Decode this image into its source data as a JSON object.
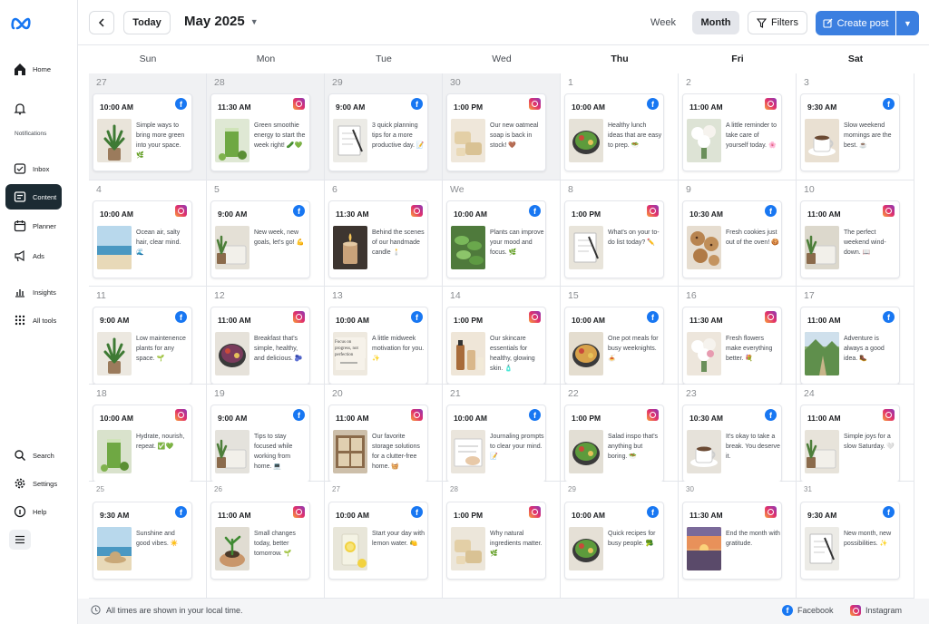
{
  "brand": {
    "logo": "meta-logo",
    "accent": "#3b7fe0",
    "facebook": "#1877f2"
  },
  "sidebar": {
    "items": [
      {
        "name": "home",
        "label": "Home",
        "icon": "home-icon"
      },
      {
        "name": "notifications",
        "label": "Notifications",
        "icon": "bell-icon"
      },
      {
        "name": "inbox",
        "label": "Inbox",
        "icon": "inbox-icon"
      },
      {
        "name": "content",
        "label": "Content",
        "icon": "content-icon",
        "active": true
      },
      {
        "name": "planner",
        "label": "Planner",
        "icon": "calendar-icon"
      },
      {
        "name": "ads",
        "label": "Ads",
        "icon": "megaphone-icon"
      },
      {
        "name": "insights",
        "label": "Insights",
        "icon": "chart-icon"
      },
      {
        "name": "all-tools",
        "label": "All tools",
        "icon": "grid-icon"
      },
      {
        "name": "search",
        "label": "Search",
        "icon": "search-icon"
      },
      {
        "name": "settings",
        "label": "Settings",
        "icon": "gear-icon"
      },
      {
        "name": "help",
        "label": "Help",
        "icon": "help-icon"
      }
    ],
    "menu_icon": "hamburger-icon"
  },
  "toolbar": {
    "today_label": "Today",
    "month_title": "May 2025",
    "week_label": "Week",
    "month_label": "Month",
    "filters_label": "Filters",
    "create_label": "Create post"
  },
  "weekdays": [
    "Sun",
    "Mon",
    "Tue",
    "Wed",
    "Thu",
    "Fri",
    "Sat"
  ],
  "weeks": [
    [
      {
        "day": "27",
        "outside": true,
        "time": "10:00 AM",
        "platform": "facebook",
        "caption": "Simple ways to bring more green into your space. 🌿",
        "image": "potted-plant"
      },
      {
        "day": "28",
        "outside": true,
        "time": "11:30 AM",
        "platform": "instagram",
        "caption": "Green smoothie energy to start the week right! 🥒💚",
        "image": "green-smoothie"
      },
      {
        "day": "29",
        "outside": true,
        "time": "9:00 AM",
        "platform": "facebook",
        "caption": "3 quick planning tips for a more productive day. 📝",
        "image": "notebook"
      },
      {
        "day": "30",
        "outside": true,
        "time": "1:00 PM",
        "platform": "instagram",
        "caption": "Our new oatmeal soap is back in stock! 🤎",
        "image": "soap"
      },
      {
        "day": "1",
        "time": "10:00 AM",
        "platform": "facebook",
        "caption": "Healthy lunch ideas that are easy to prep. 🥗",
        "image": "salad-bowl"
      },
      {
        "day": "2",
        "time": "11:00 AM",
        "platform": "instagram",
        "caption": "A little reminder to take care of yourself today. 🌸",
        "image": "white-flowers"
      },
      {
        "day": "3",
        "time": "9:30 AM",
        "platform": "facebook",
        "caption": "Slow weekend mornings are the best. ☕",
        "image": "coffee-cup"
      }
    ],
    [
      {
        "day": "4",
        "time": "10:00 AM",
        "platform": "instagram",
        "caption": "Ocean air, salty hair, clear mind. 🌊",
        "image": "ocean"
      },
      {
        "day": "5",
        "time": "9:00 AM",
        "platform": "facebook",
        "caption": "New week, new goals, let's go! 💪",
        "image": "plant-towel"
      },
      {
        "day": "6",
        "time": "11:30 AM",
        "platform": "instagram",
        "caption": "Behind the scenes of our handmade candle 🕯️",
        "image": "candle"
      },
      {
        "day": "We",
        "time": "10:00 AM",
        "platform": "facebook",
        "caption": "Plants can improve your mood and focus. 🌿",
        "image": "leafy-plant"
      },
      {
        "day": "8",
        "time": "1:00 PM",
        "platform": "instagram",
        "caption": "What's on your to-do list today? ✏️",
        "image": "todo-notebook"
      },
      {
        "day": "9",
        "time": "10:30 AM",
        "platform": "facebook",
        "caption": "Fresh cookies just out of the oven! 🍪",
        "image": "cookies"
      },
      {
        "day": "10",
        "time": "11:00 AM",
        "platform": "instagram",
        "caption": "The perfect weekend wind-down. 📖",
        "image": "plant-book"
      }
    ],
    [
      {
        "day": "11",
        "time": "9:00 AM",
        "platform": "facebook",
        "caption": "Low maintenence plants for any space. 🌱",
        "image": "snake-plant"
      },
      {
        "day": "12",
        "time": "11:00 AM",
        "platform": "instagram",
        "caption": "Breakfast that's simple, healthy, and delicious. 🫐",
        "image": "berry-bowl"
      },
      {
        "day": "13",
        "time": "10:00 AM",
        "platform": "facebook",
        "caption": "A little midweek motivation for you. ✨",
        "image": "quote-card",
        "image_text": "Focus on progress, not perfection"
      },
      {
        "day": "14",
        "time": "1:00 PM",
        "platform": "instagram",
        "caption": "Our skincare essentials for healthy, glowing skin. 🧴",
        "image": "skincare"
      },
      {
        "day": "15",
        "time": "10:00 AM",
        "platform": "facebook",
        "caption": "One pot meals for busy weeknights. 🍝",
        "image": "pasta"
      },
      {
        "day": "16",
        "time": "11:30 AM",
        "platform": "instagram",
        "caption": "Fresh flowers make everything better. 💐",
        "image": "flower-vase"
      },
      {
        "day": "17",
        "time": "11:00 AM",
        "platform": "facebook",
        "caption": "Adventure is always a good idea. 🥾",
        "image": "mountain-trail"
      }
    ],
    [
      {
        "day": "18",
        "time": "10:00 AM",
        "platform": "instagram",
        "caption": "Hydrate, nourish, repeat. ✅💚",
        "image": "green-juice"
      },
      {
        "day": "19",
        "time": "9:00 AM",
        "platform": "facebook",
        "caption": "Tips to stay focused while working from home. 💻",
        "image": "laptop-plant"
      },
      {
        "day": "20",
        "time": "11:00 AM",
        "platform": "instagram",
        "caption": "Our favorite storage solutions for a clutter-free home. 🧺",
        "image": "storage-shelves"
      },
      {
        "day": "21",
        "time": "10:00 AM",
        "platform": "facebook",
        "caption": "Journaling prompts to clear your mind. 📝",
        "image": "journaling"
      },
      {
        "day": "22",
        "time": "1:00 PM",
        "platform": "instagram",
        "caption": "Salad inspo that's anything but boring. 🥗",
        "image": "salad-plate"
      },
      {
        "day": "23",
        "time": "10:30 AM",
        "platform": "facebook",
        "caption": "It's okay to take a break. You deserve it.",
        "image": "white-mug"
      },
      {
        "day": "24",
        "time": "11:00 AM",
        "platform": "instagram",
        "caption": "Simple joys for a slow Saturday. 🤍",
        "image": "cozy-chair"
      }
    ],
    [
      {
        "day": "25",
        "small": true,
        "time": "9:30 AM",
        "platform": "facebook",
        "caption": "Sunshine and good vibes. ☀️",
        "image": "beach-hat"
      },
      {
        "day": "26",
        "small": true,
        "time": "11:00 AM",
        "platform": "instagram",
        "caption": "Small changes today, better tomorrow. 🌱",
        "image": "seedling-hands"
      },
      {
        "day": "27",
        "small": true,
        "time": "10:00 AM",
        "platform": "facebook",
        "caption": "Start your day with lemon water. 🍋",
        "image": "lemon-water"
      },
      {
        "day": "28",
        "small": true,
        "time": "1:00 PM",
        "platform": "instagram",
        "caption": "Why natural ingredients matter. 🌿",
        "image": "soap-bars"
      },
      {
        "day": "29",
        "small": true,
        "time": "10:00 AM",
        "platform": "facebook",
        "caption": "Quick recipes for busy people. 🥦",
        "image": "veggie-bowl"
      },
      {
        "day": "30",
        "small": true,
        "time": "11:30 AM",
        "platform": "instagram",
        "caption": "End the month with gratitude.",
        "image": "sunset"
      },
      {
        "day": "31",
        "small": true,
        "time": "9:30 AM",
        "platform": "facebook",
        "caption": "New month, new possibilities. ✨",
        "image": "planner-pen"
      }
    ]
  ],
  "footer": {
    "note": "All times are shown in your local time.",
    "legend_facebook": "Facebook",
    "legend_instagram": "Instagram"
  }
}
